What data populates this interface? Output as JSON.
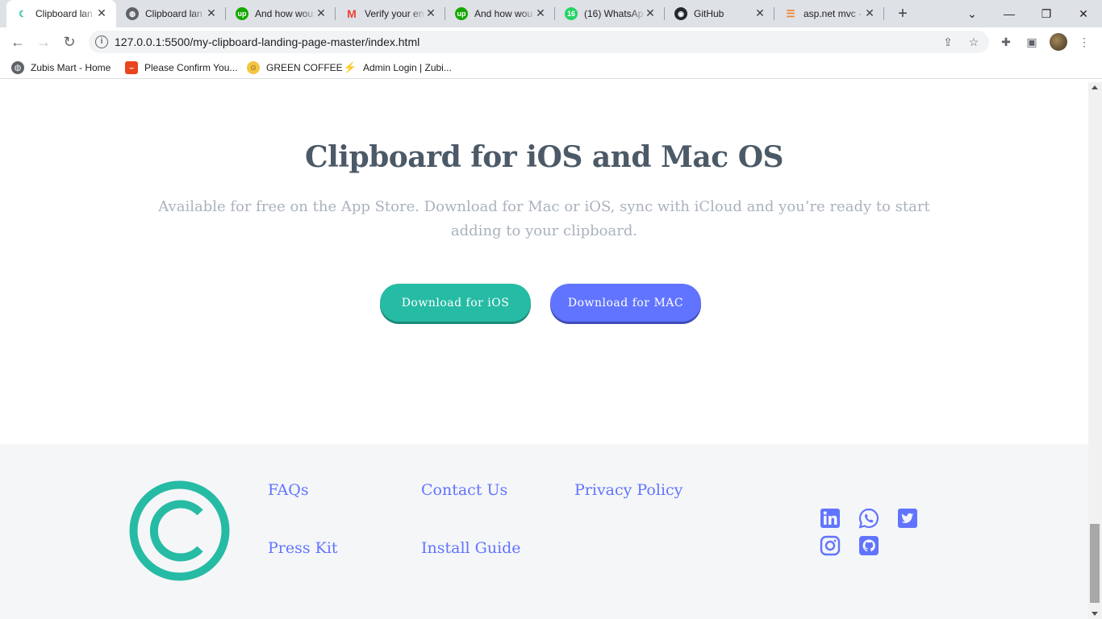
{
  "browser": {
    "tabs": [
      {
        "title": "Clipboard lan",
        "icon": "clipboard-favicon",
        "active": true
      },
      {
        "title": "Clipboard lan",
        "icon": "globe-favicon"
      },
      {
        "title": "And how wou",
        "icon": "upwork-favicon"
      },
      {
        "title": "Verify your en",
        "icon": "gmail-favicon"
      },
      {
        "title": "And how wou",
        "icon": "upwork-favicon"
      },
      {
        "title": "(16) WhatsAp",
        "icon": "whatsapp-favicon",
        "badge": "16"
      },
      {
        "title": "GitHub",
        "icon": "github-favicon"
      },
      {
        "title": "asp.net mvc -",
        "icon": "stackoverflow-favicon"
      }
    ],
    "url": "127.0.0.1:5500/my-clipboard-landing-page-master/index.html",
    "bookmarks": [
      {
        "label": "Zubis Mart - Home",
        "icon": "globe-icon"
      },
      {
        "label": "Please Confirm You...",
        "icon": "shop-icon"
      },
      {
        "label": "GREEN COFFEE",
        "icon": "smiley-icon"
      },
      {
        "label": "Admin Login | Zubi...",
        "icon": "zubi-icon"
      }
    ]
  },
  "page": {
    "heading": "Clipboard for iOS and Mac OS",
    "subtext": "Available for free on the App Store. Download for Mac or iOS, sync with iCloud and you’re ready to start adding to your clipboard.",
    "buttons": {
      "ios": "Download for iOS",
      "mac": "Download for MAC"
    },
    "footer": {
      "links": [
        "FAQs",
        "Contact Us",
        "Privacy Policy",
        "Press Kit",
        "Install Guide"
      ],
      "social": [
        "linkedin-icon",
        "whatsapp-icon",
        "twitter-icon",
        "instagram-icon",
        "github-icon"
      ]
    }
  },
  "colors": {
    "accent_teal": "#26bba4",
    "accent_blue": "#6174ff",
    "heading": "#4c5a67",
    "subtext": "#aab2bd",
    "footer_bg": "#f5f6f8"
  }
}
